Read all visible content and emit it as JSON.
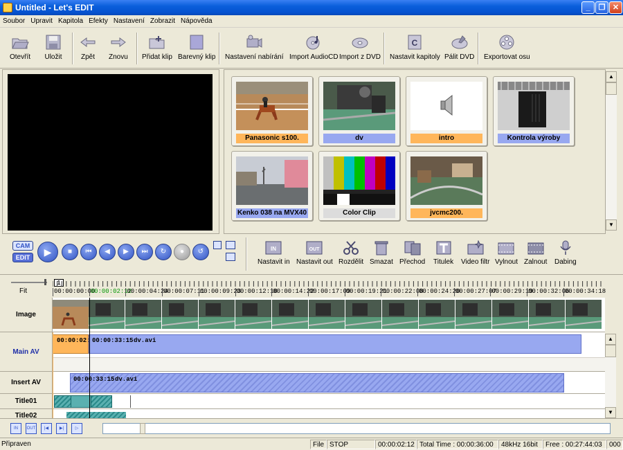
{
  "window": {
    "title": "Untitled - Let's EDIT"
  },
  "menu": [
    "Soubor",
    "Upravit",
    "Kapitola",
    "Efekty",
    "Nastavení",
    "Zobrazit",
    "Nápověda"
  ],
  "toolbar": {
    "open": "Otevřít",
    "save": "Uložit",
    "undo": "Zpět",
    "redo": "Znovu",
    "add_clip": "Přidat klip",
    "color_clip": "Barevný klip",
    "capture_settings": "Nastavení nabírání",
    "import_audiocd": "Import AudioCD",
    "import_dvd": "Import z DVD",
    "set_chapters": "Nastavit kapitoly",
    "burn_dvd": "Pálit DVD",
    "export_axis": "Exportovat osu"
  },
  "library": {
    "clips": [
      {
        "label": "Panasonic s100.",
        "label_color": "orange",
        "kind": "horse"
      },
      {
        "label": "dv",
        "label_color": "blue",
        "kind": "machine"
      },
      {
        "label": "intro",
        "label_color": "orange",
        "kind": "audio"
      },
      {
        "label": "Kontrola výroby",
        "label_color": "blue",
        "kind": "closeup"
      },
      {
        "label": "Kenko 038 na MVX40",
        "label_color": "blue",
        "kind": "street"
      },
      {
        "label": "Color Clip",
        "label_color": "gray",
        "kind": "colorbars"
      },
      {
        "label": "jvcmc200.",
        "label_color": "orange",
        "kind": "railway"
      }
    ]
  },
  "playback": {
    "cam": "CAM",
    "edit": "EDIT"
  },
  "edit_tools": {
    "set_in": "Nastavit in",
    "set_out": "Nastavit out",
    "split": "Rozdělit",
    "delete": "Smazat",
    "transition": "Přechod",
    "title": "Titulek",
    "video_filter": "Video filtr",
    "fade_out": "Vylnout",
    "fade_in": "Zalnout",
    "dubbing": "Dabing",
    "in_icon": "IN",
    "out_icon": "OUT"
  },
  "timeline": {
    "fit": "Fit",
    "marker": "1",
    "current_time": "00:00:02:12",
    "timecodes": [
      "00:00:00:00",
      "00:00:02:12",
      "00:00:04:24",
      "00:00:07:11",
      "00:00:09:23",
      "00:00:12:10",
      "00:00:14:22",
      "00:00:17:09",
      "00:00:19:21",
      "00:00:22:08",
      "00:00:24:20",
      "00:00:27:07",
      "00:00:29:19",
      "00:00:32:06",
      "00:00:34:18"
    ],
    "tracks": {
      "image": "Image",
      "main_av": "Main AV",
      "insert_av": "Insert AV",
      "title01": "Title01",
      "title02": "Title02"
    },
    "main_av_clip1_time": "00:00:02:",
    "main_av_clip2_time": "00:00:33:15",
    "main_av_clip2_name": "dv.avi",
    "insert_clip_time": "00:00:33:15",
    "insert_clip_name": "dv.avi"
  },
  "bottom_buttons": [
    "IN",
    "OUT",
    "|◀",
    "▶|",
    "▷"
  ],
  "status": {
    "ready": "Připraven",
    "file": "File",
    "state": "STOP",
    "position": "00:00:02:12",
    "total": "Total Time : 00:00:36:00",
    "audio": "48kHz 16bit",
    "free": "Free : 00:27:44:03",
    "misc": "000"
  },
  "colors": {
    "accent": "#98a8f0",
    "orange": "#ffb65a",
    "selection": "#ffb65a"
  }
}
